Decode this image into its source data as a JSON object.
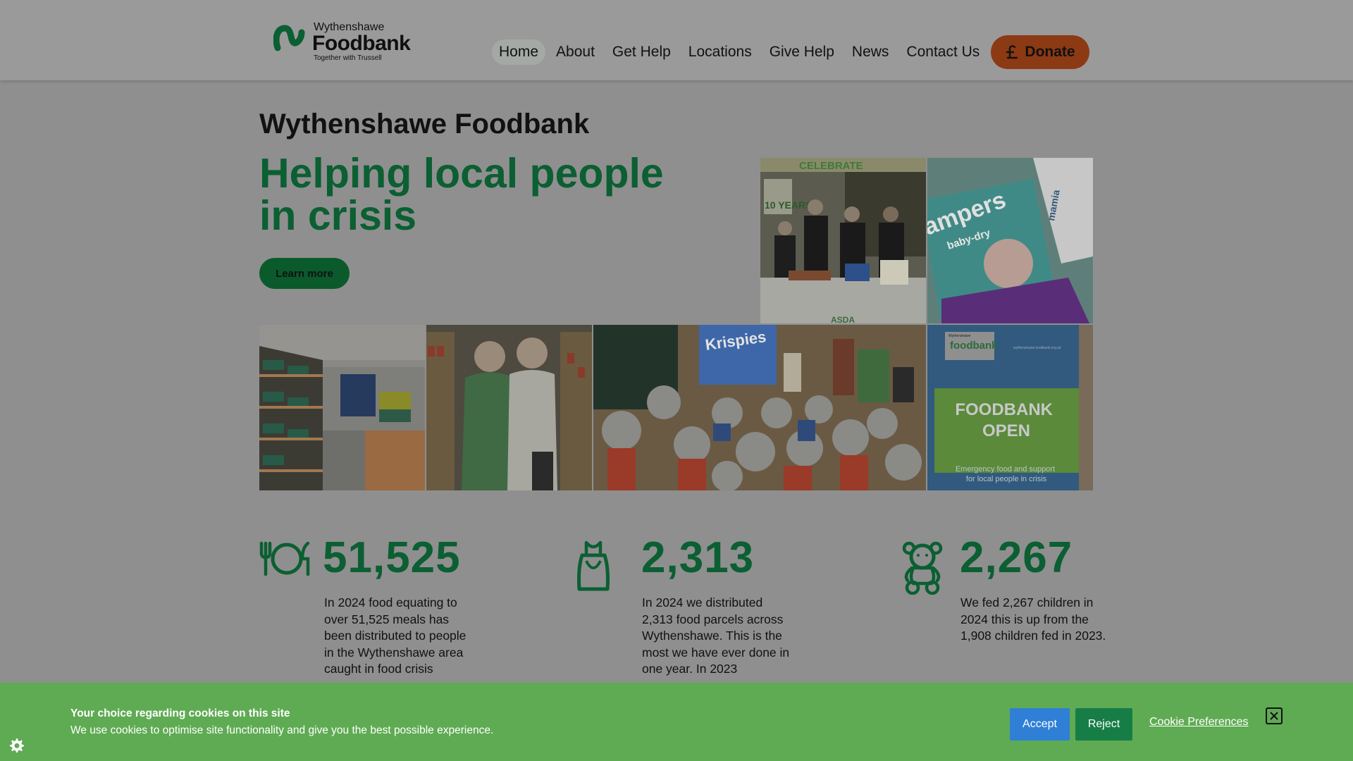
{
  "header": {
    "logo": {
      "top": "Wythenshawe",
      "main": "Foodbank",
      "tagline": "Together with Trussell"
    },
    "nav": [
      "Home",
      "About",
      "Get Help",
      "Locations",
      "Give Help",
      "News",
      "Contact Us"
    ],
    "active_nav": "Home",
    "donate_label": "Donate"
  },
  "hero": {
    "site_title": "Wythenshawe Foodbank",
    "headline": "Helping local people in crisis",
    "cta_label": "Learn more"
  },
  "gallery": {
    "celebrate_banner": "CELEBRATE",
    "years_badge": "10 YEARS",
    "supermarket": "ASDA",
    "nappies_brand": "ampers",
    "nappies_sub": "baby-dry",
    "mama_text": "mamia",
    "cereal_brand": "Krispies",
    "sign_logo": "foodbank",
    "sign_logo_small": "Wythenshawe",
    "sign_url": "wythenshawe.foodbank.org.uk",
    "sign_heading": "FOODBANK OPEN",
    "sign_subtext": "Emergency food and support for local people in crisis"
  },
  "stats": [
    {
      "icon": "plate-cutlery-icon",
      "number": "51,525",
      "text": "In 2024 food equating to over 51,525 meals has been distributed to people in the Wythenshawe area caught in food crisis.",
      "visible_text": "In 2024 food equating to over 51,525 meals has been distributed to people in the Wythenshawe area caught in food crisis"
    },
    {
      "icon": "bag-icon",
      "number": "2,313",
      "text": "In 2024 we distributed 2,313 food parcels across Wythenshawe. This is the most we have ever done in one year.",
      "visible_text": "In 2024 we distributed 2,313 food parcels across Wythenshawe. This is the most we have ever done in one year. In 2023"
    },
    {
      "icon": "teddy-bear-icon",
      "number": "2,267",
      "text": "We fed 2,267 children in 2024 this is up from the 1,908 children fed in 2023."
    }
  ],
  "cookie": {
    "title": "Your choice regarding cookies on this site",
    "body": "We use cookies to optimise site functionality and give you the best possible experience.",
    "accept": "Accept",
    "reject": "Reject",
    "preferences": "Cookie Preferences"
  },
  "colors": {
    "brand_green": "#0b5f32",
    "donate": "#8c3a14",
    "cookie_bg": "#5fab53",
    "accept_blue": "#2f7fd6"
  }
}
